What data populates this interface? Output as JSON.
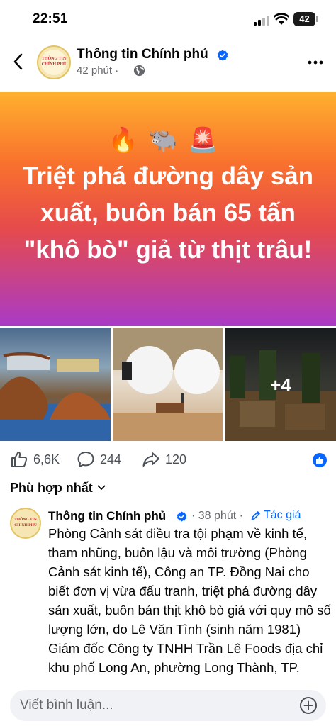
{
  "status_bar": {
    "time": "22:51",
    "battery": "42"
  },
  "post": {
    "page_name": "Thông tin Chính phủ",
    "time": "42 phút",
    "separator": "·",
    "avatar_lines": [
      "THÔNG TIN",
      "CHÍNH PHỦ"
    ],
    "banner": {
      "emojis": "🔥🐃🚨",
      "title": "Triệt phá đường dây sản xuất, buôn bán 65 tấn \"khô bò\" giả từ thịt trâu!"
    },
    "photos": {
      "more_count": "+4"
    },
    "stats": {
      "likes": "6,6K",
      "comments": "244",
      "shares": "120"
    }
  },
  "comments_section": {
    "sort_label": "Phù hợp nhất",
    "comments": [
      {
        "author": "Thông tin Chính phủ",
        "separator": "·",
        "time": "38 phút",
        "badge": "Tác giả",
        "text": "Phòng Cảnh sát điều tra tội phạm về kinh tế, tham nhũng, buôn lậu và môi trường (Phòng Cảnh sát kinh tế), Công an TP. Đồng Nai cho biết đơn vị vừa đấu tranh, triệt phá đường dây sản xuất, buôn bán thịt khô bò giả với quy mô số lượng lớn, do Lê Văn Tình (sinh năm 1981) Giám đốc Công ty TNHH Trần Lê Foods địa chỉ khu phố Long An, phường Long Thành, TP."
      }
    ]
  },
  "composer": {
    "placeholder": "Viết bình luận..."
  },
  "colors": {
    "accent": "#0866ff",
    "secondary_text": "#65676b",
    "banner_top": "#ffb02e",
    "banner_bottom": "#a93ac7"
  },
  "icons": [
    "back-arrow-icon",
    "verified-badge-icon",
    "globe-icon",
    "more-options-icon",
    "like-icon",
    "comment-icon",
    "share-icon",
    "like-reaction-icon",
    "chevron-down-icon",
    "pencil-icon",
    "plus-circle-icon"
  ]
}
